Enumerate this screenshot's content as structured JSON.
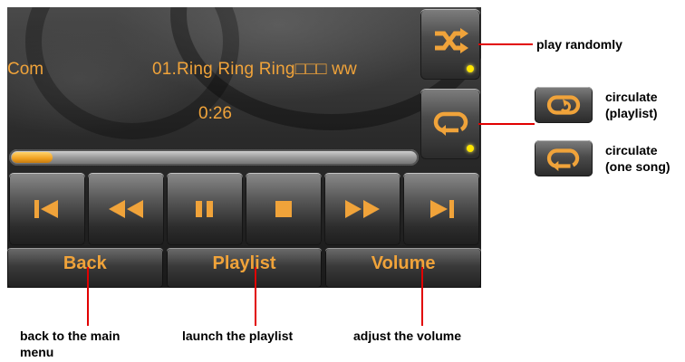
{
  "player": {
    "track_left": "Com",
    "track_title": "01.Ring Ring Ring□□□ ww",
    "time": "0:26",
    "progress": 0.1,
    "accent": "#f0a33a",
    "led_color": "#ffe600",
    "shuffle_icon": "shuffle-icon",
    "repeat_icon": "repeat-icon",
    "controls": [
      "previous-track-icon",
      "rewind-icon",
      "pause-icon",
      "stop-icon",
      "fast-forward-icon",
      "next-track-icon"
    ],
    "buttons": {
      "back": "Back",
      "playlist": "Playlist",
      "volume": "Volume"
    }
  },
  "annotations": {
    "play_randomly": "play randomly",
    "circulate_playlist": [
      "circulate",
      "(playlist)"
    ],
    "circulate_one_song": [
      "circulate",
      "(one song)"
    ],
    "back_note": [
      "back to the main",
      "menu"
    ],
    "playlist_note": "launch the playlist",
    "volume_note": "adjust the volume",
    "line_color": "#e10000"
  }
}
